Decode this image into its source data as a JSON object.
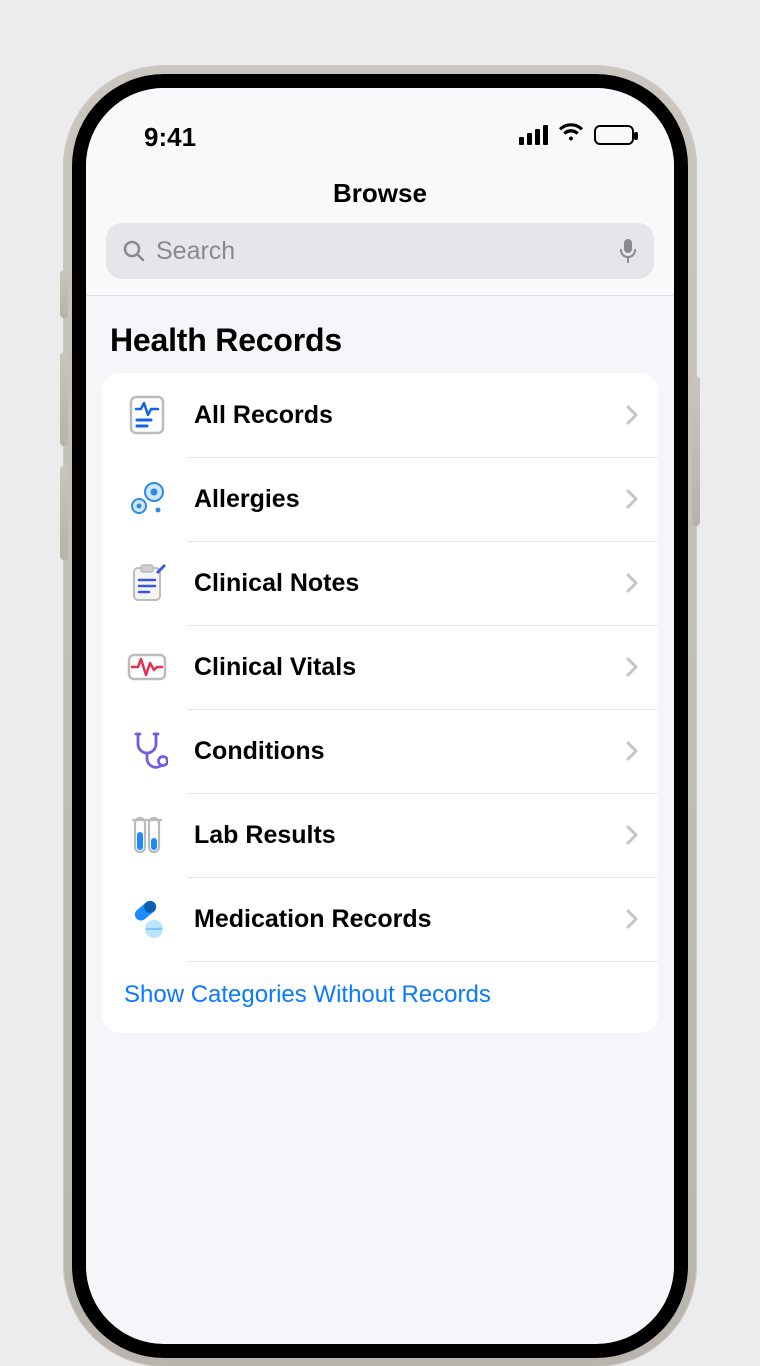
{
  "statusbar": {
    "time": "9:41"
  },
  "nav": {
    "title": "Browse"
  },
  "search": {
    "placeholder": "Search"
  },
  "section": {
    "title": "Health Records"
  },
  "rows": [
    {
      "label": "All Records"
    },
    {
      "label": "Allergies"
    },
    {
      "label": "Clinical Notes"
    },
    {
      "label": "Clinical Vitals"
    },
    {
      "label": "Conditions"
    },
    {
      "label": "Lab Results"
    },
    {
      "label": "Medication Records"
    }
  ],
  "show_link": "Show Categories Without Records"
}
